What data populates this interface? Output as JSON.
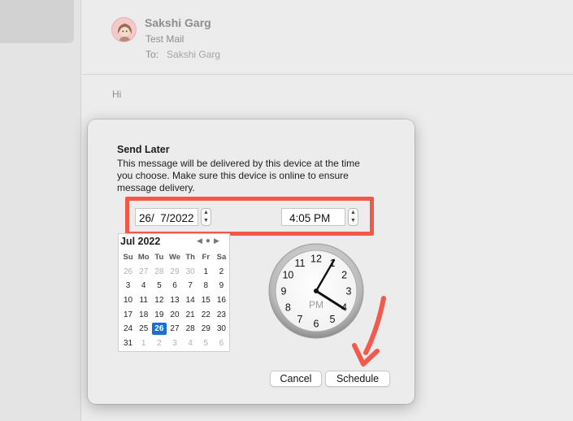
{
  "mail": {
    "sender": "Sakshi Garg",
    "subject": "Test Mail",
    "to_label": "To:",
    "to_value": "Sakshi Garg",
    "body": "Hi"
  },
  "dialog": {
    "title": "Send Later",
    "description": "This message will be delivered by this device at the time you choose. Make sure this device is online to ensure message delivery.",
    "date_value": "26/  7/2022",
    "time_value": "4:05 PM",
    "cancel_label": "Cancel",
    "schedule_label": "Schedule",
    "highlight_color": "#f0584a"
  },
  "calendar": {
    "month_label": "Jul 2022",
    "weekdays": [
      "Su",
      "Mo",
      "Tu",
      "We",
      "Th",
      "Fr",
      "Sa"
    ],
    "weeks": [
      [
        "26",
        "27",
        "28",
        "29",
        "30",
        "1",
        "2"
      ],
      [
        "3",
        "4",
        "5",
        "6",
        "7",
        "8",
        "9"
      ],
      [
        "10",
        "11",
        "12",
        "13",
        "14",
        "15",
        "16"
      ],
      [
        "17",
        "18",
        "19",
        "20",
        "21",
        "22",
        "23"
      ],
      [
        "24",
        "25",
        "26",
        "27",
        "28",
        "29",
        "30"
      ],
      [
        "31",
        "1",
        "2",
        "3",
        "4",
        "5",
        "6"
      ]
    ],
    "selected_day": "26",
    "accent_color": "#1a6fd7"
  },
  "clock": {
    "hour": 4,
    "minute": 5,
    "ampm": "PM",
    "numbers": [
      "12",
      "1",
      "2",
      "3",
      "4",
      "5",
      "6",
      "7",
      "8",
      "9",
      "10",
      "11"
    ]
  }
}
